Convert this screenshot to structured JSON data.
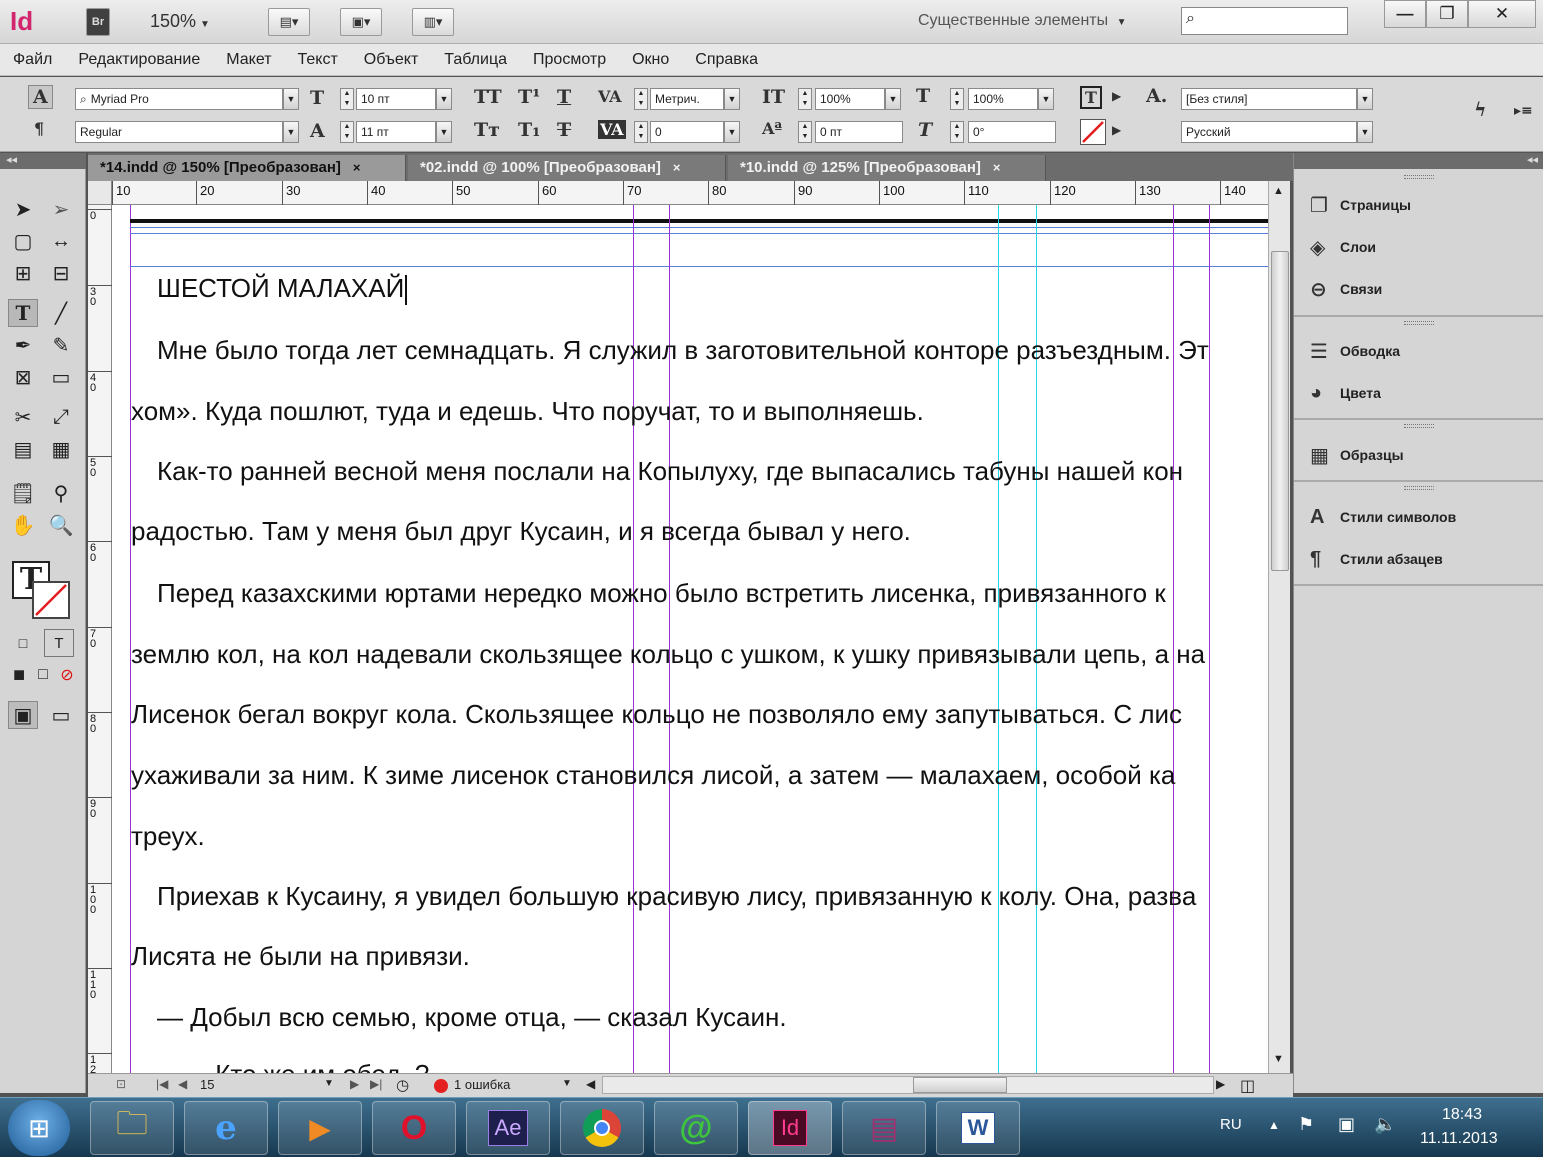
{
  "titlebar": {
    "app_logo": "Id",
    "bridge": "Br",
    "zoom": "150%",
    "workspace": "Существенные элементы",
    "minimize": "—",
    "maximize": "❐",
    "close": "✕"
  },
  "menu": [
    "Файл",
    "Редактирование",
    "Макет",
    "Текст",
    "Объект",
    "Таблица",
    "Просмотр",
    "Окно",
    "Справка"
  ],
  "control": {
    "font_family": "Myriad Pro",
    "font_style": "Regular",
    "font_size": "10 пт",
    "leading": "11 пт",
    "kerning": "Метрич.",
    "tracking": "0",
    "vscale": "100%",
    "hscale": "100%",
    "baseline": "0 пт",
    "skew": "0°",
    "char_style": "[Без стиля]",
    "language": "Русский"
  },
  "tabs": [
    {
      "label": "*14.indd @ 150% [Преобразован]",
      "close": "×"
    },
    {
      "label": "*02.indd @ 100% [Преобразован]",
      "close": "×"
    },
    {
      "label": "*10.indd @ 125% [Преобразован]",
      "close": "×"
    }
  ],
  "ruler": {
    "h_ticks": [
      "10",
      "20",
      "30",
      "40",
      "50",
      "60",
      "70",
      "80",
      "90",
      "100",
      "110",
      "120",
      "130",
      "140"
    ],
    "v_ticks": [
      "0",
      "3\n0",
      "4\n0",
      "5\n0",
      "6\n0",
      "7\n0",
      "8\n0",
      "9\n0",
      "1\n0\n0",
      "1\n1\n0",
      "1\n2"
    ]
  },
  "document": {
    "heading": "ШЕСТОЙ МАЛАХАЙ",
    "lines": [
      "Мне было тогда лет семнадцать. Я служил в заготовительной конторе разъездным. Эт",
      "хом». Куда пошлют, туда и едешь. Что поручат, то и выполняешь.",
      "Как-то ранней весной меня послали на Копылуху, где выпасались табуны нашей кон",
      "радостью. Там у меня был друг Кусаин, и я всегда бывал у него.",
      "Перед казахскими юртами нередко можно было встретить лисенка, привязанного к",
      "землю кол, на кол надевали скользящее кольцо с ушком, к ушку привязывали цепь, а на",
      "Лисенок бегал вокруг кола. Скользящее кольцо не позволяло ему запутываться. С лис",
      "ухаживали за ним. К зиме лисенок становился лисой, а затем — малахаем, особой ка",
      "треух.",
      "Приехав к Кусаину, я увидел большую красивую лису, привязанную к колу. Она, разва",
      "Лисята не были на привязи.",
      "— Добыл всю семью, кроме отца, — сказал Кусаин.",
      "— Кто же им обед..?"
    ]
  },
  "statusbar": {
    "page": "15",
    "errors": "1 ошибка"
  },
  "panels": [
    {
      "label": "Страницы",
      "icon": "pages-icon"
    },
    {
      "label": "Слои",
      "icon": "layers-icon"
    },
    {
      "label": "Связи",
      "icon": "links-icon"
    },
    {
      "label": "Обводка",
      "icon": "stroke-icon"
    },
    {
      "label": "Цвета",
      "icon": "color-icon"
    },
    {
      "label": "Образцы",
      "icon": "swatches-icon"
    },
    {
      "label": "Стили символов",
      "icon": "character-styles-icon"
    },
    {
      "label": "Стили абзацев",
      "icon": "paragraph-styles-icon"
    }
  ],
  "taskbar": {
    "apps": [
      "Проводник",
      "Internet Explorer",
      "Media Player",
      "Opera",
      "Ae",
      "Chrome",
      "Mail.Ru Agent",
      "Id",
      "WinRAR",
      "Word"
    ],
    "lang": "RU",
    "time": "18:43",
    "date": "11.11.2013"
  },
  "colors": {
    "accent": "#d3246e",
    "guide_purple": "#9b30d9",
    "guide_cyan": "#25d6e8",
    "margin_blue": "#5b7fd6"
  }
}
